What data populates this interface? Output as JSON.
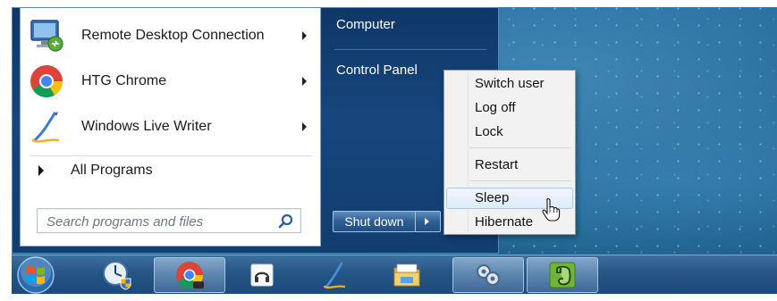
{
  "start_menu": {
    "programs": [
      {
        "label": "Remote Desktop Connection",
        "icon": "remote-desktop-icon",
        "has_submenu": true
      },
      {
        "label": "HTG Chrome",
        "icon": "chrome-icon",
        "has_submenu": true
      },
      {
        "label": "Windows Live Writer",
        "icon": "live-writer-icon",
        "has_submenu": true
      }
    ],
    "all_programs_label": "All Programs",
    "search_placeholder": "Search programs and files",
    "right_links": [
      "Computer",
      "Control Panel"
    ],
    "shutdown_label": "Shut down"
  },
  "power_menu": {
    "items": [
      "Switch user",
      "Log off",
      "Lock",
      "Restart",
      "Sleep",
      "Hibernate"
    ],
    "highlighted": "Sleep"
  },
  "taskbar": {
    "items": [
      {
        "icon": "windows-start-orb-icon"
      },
      {
        "icon": "security-clock-icon"
      },
      {
        "icon": "chrome-icon",
        "active": true
      },
      {
        "icon": "audio-player-icon"
      },
      {
        "icon": "live-writer-icon"
      },
      {
        "icon": "file-explorer-icon"
      },
      {
        "icon": "remote-desktop-icon",
        "active": true
      },
      {
        "icon": "evernote-icon",
        "active": true
      }
    ]
  },
  "colors": {
    "start_menu_blue": "#123d70",
    "desktop_blue": "#216a9c",
    "menu_highlight": "#dcebfc",
    "taskbar": "#255585"
  }
}
